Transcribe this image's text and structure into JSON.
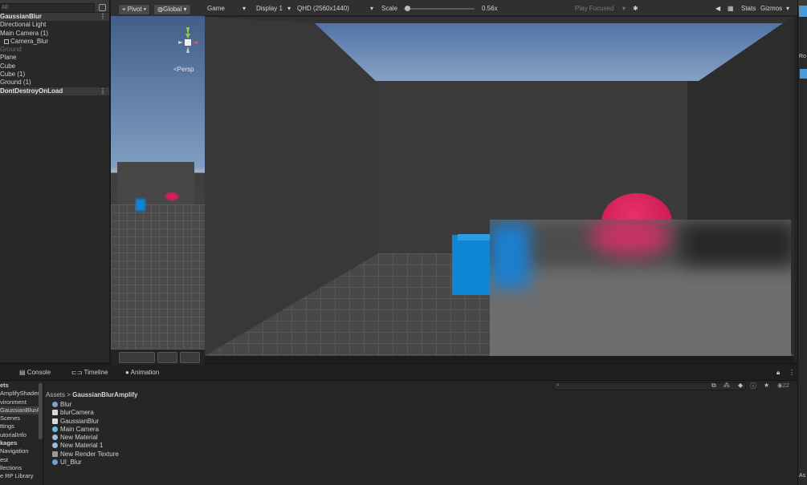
{
  "hierarchy": {
    "search_placeholder": "All",
    "items": [
      {
        "label": "GaussianBlur",
        "type": "scene"
      },
      {
        "label": "Directional Light",
        "type": "obj"
      },
      {
        "label": "Main Camera (1)",
        "type": "obj"
      },
      {
        "label": "Camera_Blur",
        "type": "child"
      },
      {
        "label": "Ground",
        "type": "dim"
      },
      {
        "label": "Plane",
        "type": "obj"
      },
      {
        "label": "Cube",
        "type": "obj"
      },
      {
        "label": "Cube (1)",
        "type": "obj"
      },
      {
        "label": "Ground (1)",
        "type": "obj"
      },
      {
        "label": "DontDestroyOnLoad",
        "type": "scene"
      }
    ]
  },
  "scene_view": {
    "pivot_label": "Pivot",
    "global_label": "Global",
    "persp_label": "<Persp"
  },
  "game_view": {
    "tab_label": "Game",
    "display": "Display 1",
    "resolution": "QHD (2560x1440)",
    "scale_label": "Scale",
    "scale_value": "0.56x",
    "scale_level": 0.05,
    "play_mode": "Play Focused",
    "stats_label": "Stats",
    "gizmos_label": "Gizmos"
  },
  "bottom_tabs": {
    "console": "Console",
    "timeline": "Timeline",
    "animation": "Animation"
  },
  "project": {
    "left_items": [
      {
        "label": "ets",
        "bold": true
      },
      {
        "label": "AmplifyShaderE",
        "bold": false
      },
      {
        "label": "vironment",
        "bold": false
      },
      {
        "label": "GaussianBlurAn",
        "bold": false
      },
      {
        "label": "Scenes",
        "bold": false
      },
      {
        "label": "ttings",
        "bold": false
      },
      {
        "label": "utorialInfo",
        "bold": false
      },
      {
        "label": "kages",
        "bold": true
      },
      {
        "label": "Navigation",
        "bold": false
      },
      {
        "label": "est",
        "bold": false
      },
      {
        "label": "llections",
        "bold": false
      },
      {
        "label": "e RP Library",
        "bold": false
      }
    ],
    "breadcrumb_root": "Assets",
    "breadcrumb_sep": ">",
    "breadcrumb_current": "GaussianBlurAmplify",
    "visible_count": "22",
    "assets": [
      {
        "label": "Blur",
        "icon": "material-icon",
        "color": "#7aa4cf"
      },
      {
        "label": "blurCamera",
        "icon": "script-icon",
        "color": "#d8d8d8"
      },
      {
        "label": "GaussianBlur",
        "icon": "shader-icon",
        "color": "#d8d8d8"
      },
      {
        "label": "Main Camera",
        "icon": "prefab-icon",
        "color": "#6cb8ea"
      },
      {
        "label": "New Material",
        "icon": "material-icon",
        "color": "#9bbde0"
      },
      {
        "label": "New Material 1",
        "icon": "material-icon",
        "color": "#9bbde0"
      },
      {
        "label": "New Render Texture",
        "icon": "render-texture-icon",
        "color": "#9a9a9a"
      },
      {
        "label": "UI_Blur",
        "icon": "material-icon",
        "color": "#6aa0d6"
      }
    ]
  },
  "inspector": {
    "partial_label_1": "Ro",
    "partial_label_2": "As"
  }
}
